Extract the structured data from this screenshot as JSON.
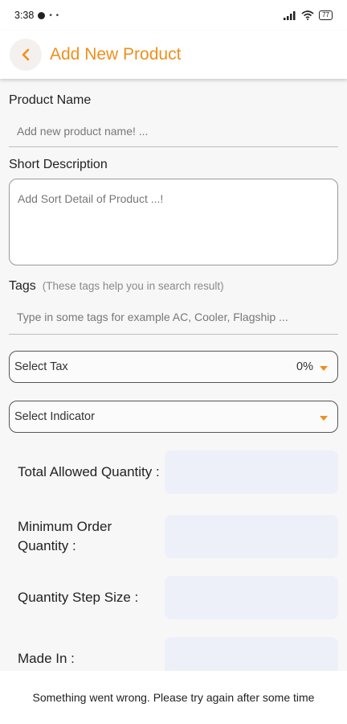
{
  "status_bar": {
    "time": "3:38",
    "battery": "77"
  },
  "header": {
    "back_icon": "chevron-left-icon",
    "title": "Add New Product"
  },
  "product_name": {
    "label": "Product Name",
    "placeholder": "Add new product name! ..."
  },
  "short_description": {
    "label": "Short Description",
    "placeholder": "Add Sort Detail of Product ...!"
  },
  "tags": {
    "label": "Tags",
    "hint": "(These tags help you in search result)",
    "placeholder": "Type in some tags for example AC, Cooler, Flagship ..."
  },
  "tax_select": {
    "label": "Select Tax",
    "value": "0%"
  },
  "indicator_select": {
    "label": "Select Indicator"
  },
  "quantity_fields": {
    "total_allowed": "Total Allowed Quantity :",
    "minimum_order": "Minimum Order Quantity :",
    "step_size": "Quantity Step Size :",
    "made_in": "Made In :"
  },
  "toast": {
    "message": "Something went wrong. Please try again after some time"
  },
  "colors": {
    "accent": "#ef8f1d",
    "input_bg": "#edf0f8"
  }
}
